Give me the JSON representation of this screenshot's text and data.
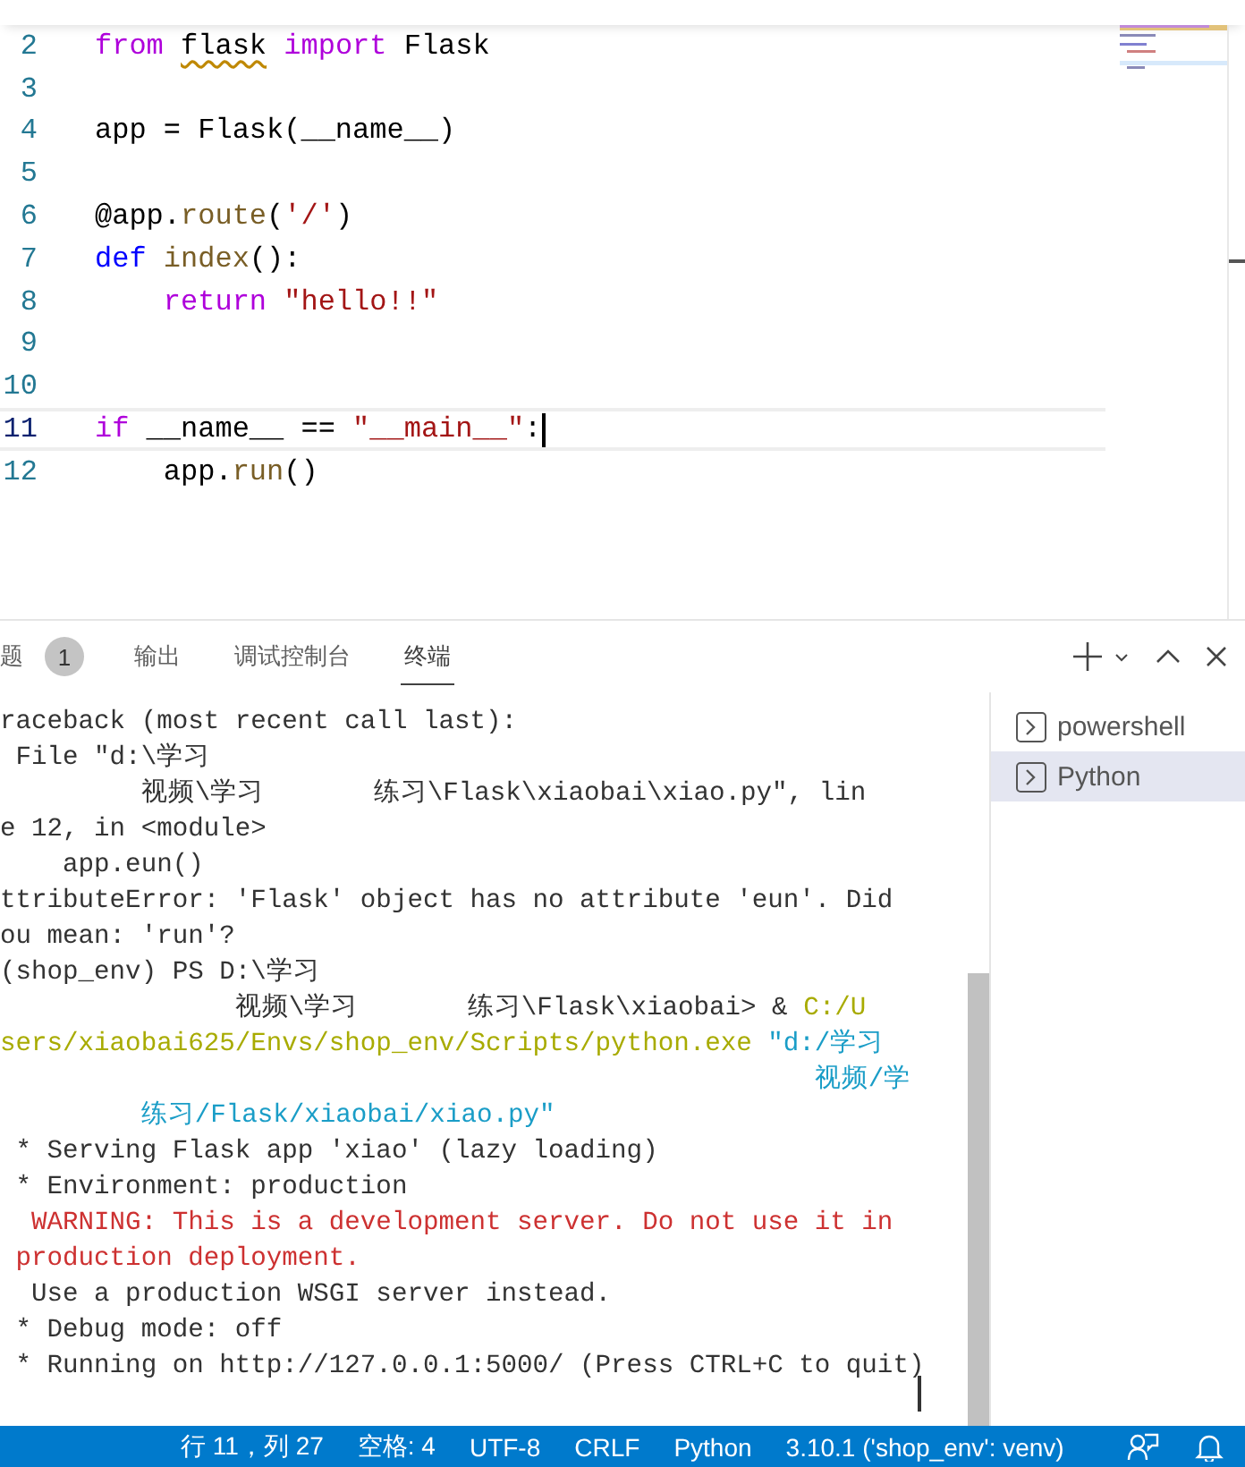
{
  "editor": {
    "lines": [
      {
        "number": "2",
        "current": false,
        "tokens": [
          {
            "text": "from ",
            "kind": "keyword"
          },
          {
            "text": "flask",
            "kind": "unresolved"
          },
          {
            "text": " import",
            "kind": "keyword"
          },
          {
            "text": " Flask",
            "kind": "plain"
          }
        ]
      },
      {
        "number": "3",
        "current": false
      },
      {
        "number": "4",
        "current": false,
        "tokens": [
          {
            "text": "app = Flask(__name__)",
            "kind": "plain"
          }
        ]
      },
      {
        "number": "5",
        "current": false
      },
      {
        "number": "6",
        "current": false,
        "tokens": [
          {
            "text": "@app.",
            "kind": "plain"
          },
          {
            "text": "route",
            "kind": "function"
          },
          {
            "text": "(",
            "kind": "plain"
          },
          {
            "text": "'/'",
            "kind": "string"
          },
          {
            "text": ")",
            "kind": "plain"
          }
        ]
      },
      {
        "number": "7",
        "current": false,
        "tokens": [
          {
            "text": "def ",
            "kind": "storage"
          },
          {
            "text": "index",
            "kind": "function"
          },
          {
            "text": "():",
            "kind": "plain"
          }
        ]
      },
      {
        "number": "8",
        "current": false,
        "tokens": [
          {
            "text": "    return ",
            "kind": "keyword"
          },
          {
            "text": "\"hello!!\"",
            "kind": "string"
          }
        ]
      },
      {
        "number": "9",
        "current": false
      },
      {
        "number": "10",
        "current": false
      },
      {
        "number": "11",
        "current": true,
        "tokens": [
          {
            "text": "if",
            "kind": "keyword"
          },
          {
            "text": " __name__ == ",
            "kind": "plain"
          },
          {
            "text": "\"__main__\"",
            "kind": "string"
          },
          {
            "text": ":",
            "kind": "plain"
          }
        ]
      },
      {
        "number": "12",
        "current": false,
        "tokens": [
          {
            "text": "    app.",
            "kind": "plain"
          },
          {
            "text": "run",
            "kind": "function"
          },
          {
            "text": "()",
            "kind": "plain"
          }
        ]
      }
    ]
  },
  "panel": {
    "tabs": [
      {
        "label": "题",
        "badge": "1",
        "selected": false
      },
      {
        "label": "输出",
        "selected": false
      },
      {
        "label": "调试控制台",
        "selected": false
      },
      {
        "label": "终端",
        "selected": true
      }
    ],
    "terminal": {
      "lines": [
        {
          "segments": [
            {
              "text": "raceback (most recent call last):",
              "kind": "output"
            }
          ]
        },
        {
          "segments": [
            {
              "text": " File \"d:\\学习",
              "kind": "output"
            }
          ]
        },
        {
          "segments": [
            {
              "text": "         视频\\学习       练习\\Flask\\xiaobai\\xiao.py\", lin",
              "kind": "output"
            }
          ]
        },
        {
          "segments": [
            {
              "text": "e 12, in <module>",
              "kind": "output"
            }
          ]
        },
        {
          "segments": [
            {
              "text": "    app.eun()",
              "kind": "output"
            }
          ]
        },
        {
          "segments": [
            {
              "text": "ttributeError: 'Flask' object has no attribute 'eun'. Did",
              "kind": "output"
            }
          ]
        },
        {
          "segments": [
            {
              "text": "ou mean: 'run'?",
              "kind": "output"
            }
          ]
        },
        {
          "segments": [
            {
              "text": "(shop_env) PS D:\\学习",
              "kind": "output"
            }
          ]
        },
        {
          "segments": [
            {
              "text": "               视频\\学习       练习\\Flask\\xiaobai> & ",
              "kind": "output"
            },
            {
              "text": "C:/U",
              "kind": "path"
            }
          ]
        },
        {
          "segments": [
            {
              "text": "sers/xiaobai625/Envs/shop_env/Scripts/python.exe ",
              "kind": "path"
            },
            {
              "text": "\"d:/学习",
              "kind": "string"
            }
          ]
        },
        {
          "segments": [
            {
              "text": "                                                    视频/学",
              "kind": "string"
            }
          ]
        },
        {
          "segments": [
            {
              "text": "         练习/Flask/xiaobai/xiao.py\"",
              "kind": "string"
            }
          ]
        },
        {
          "segments": [
            {
              "text": " * Serving Flask app 'xiao' (lazy loading)",
              "kind": "output"
            }
          ]
        },
        {
          "segments": [
            {
              "text": " * Environment: production",
              "kind": "output"
            }
          ]
        },
        {
          "segments": [
            {
              "text": "  WARNING: This is a development server. Do not use it in",
              "kind": "error"
            }
          ]
        },
        {
          "segments": [
            {
              "text": " production deployment.",
              "kind": "error"
            }
          ]
        },
        {
          "segments": [
            {
              "text": "  Use a production WSGI server instead.",
              "kind": "output"
            }
          ]
        },
        {
          "segments": [
            {
              "text": " * Debug mode: off",
              "kind": "output"
            }
          ]
        },
        {
          "segments": [
            {
              "text": " * Running on http://127.0.0.1:5000/ (Press CTRL+C to quit)",
              "kind": "output"
            }
          ]
        }
      ]
    },
    "shells": [
      {
        "name": "powershell",
        "selected": false
      },
      {
        "name": "Python",
        "selected": true
      }
    ]
  },
  "status_bar": {
    "items": [
      "行 11，列 27",
      "空格: 4",
      "UTF-8",
      "CRLF",
      "Python",
      "3.10.1 ('shop_env': venv)"
    ]
  }
}
